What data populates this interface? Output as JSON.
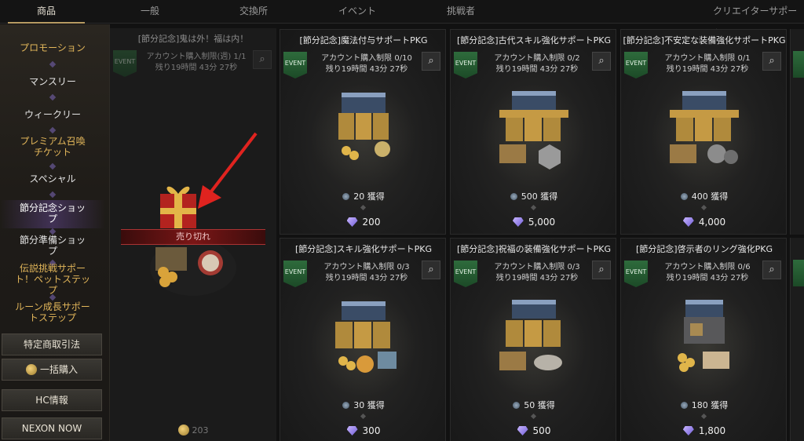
{
  "top_tabs": [
    {
      "label": "商品",
      "active": true
    },
    {
      "label": "一般",
      "active": false
    },
    {
      "label": "交換所",
      "active": false
    },
    {
      "label": "イベント",
      "active": false
    },
    {
      "label": "挑戦者",
      "active": false
    },
    {
      "label": "クリエイターサポート",
      "active": false
    }
  ],
  "sidebar": {
    "items": [
      {
        "label": "プロモーション"
      },
      {
        "label": "マンスリー"
      },
      {
        "label": "ウィークリー"
      },
      {
        "label": "プレミアム召喚チケット"
      },
      {
        "label": "スペシャル"
      },
      {
        "label": "節分記念ショップ"
      },
      {
        "label": "節分準備ショップ"
      },
      {
        "label": "伝説挑戦サポート！ペットステップ"
      },
      {
        "label": "ルーン成長サポートステップ"
      }
    ],
    "buttons": {
      "legal": "特定商取引法",
      "bulk": "一括購入",
      "hc": "HC情報",
      "nexon": "NEXON NOW"
    }
  },
  "promo_card": {
    "title": "[節分記念]鬼は外！福は内！",
    "limit": "アカウント購入制限(週) 1/1",
    "remaining": "残り19時間 43分 27秒",
    "badge": "EVENT",
    "soldout": "売り切れ",
    "price": "203"
  },
  "cards": [
    {
      "title": "[節分記念]魔法付与サポートPKG",
      "limit": "アカウント購入制限 0/10",
      "remaining": "残り19時間 43分 27秒",
      "badge": "EVENT",
      "obtain": "20 獲得",
      "price": "200"
    },
    {
      "title": "[節分記念]古代スキル強化サポートPKG",
      "limit": "アカウント購入制限 0/2",
      "remaining": "残り19時間 43分 27秒",
      "badge": "EVENT",
      "obtain": "500 獲得",
      "price": "5,000"
    },
    {
      "title": "[節分記念]不安定な装備強化サポートPKG",
      "limit": "アカウント購入制限 0/1",
      "remaining": "残り19時間 43分 27秒",
      "badge": "EVENT",
      "obtain": "400 獲得",
      "price": "4,000"
    },
    {
      "title": "[節分記念]スキル強化サポートPKG",
      "limit": "アカウント購入制限 0/3",
      "remaining": "残り19時間 43分 27秒",
      "badge": "EVENT",
      "obtain": "30 獲得",
      "price": "300"
    },
    {
      "title": "[節分記念]祝福の装備強化サポートPKG",
      "limit": "アカウント購入制限 0/3",
      "remaining": "残り19時間 43分 27秒",
      "badge": "EVENT",
      "obtain": "50 獲得",
      "price": "500"
    },
    {
      "title": "[節分記念]啓示者のリング強化PKG",
      "limit": "アカウント購入制限 0/6",
      "remaining": "残り19時間 43分 27秒",
      "badge": "EVENT",
      "obtain": "180 獲得",
      "price": "1,800"
    }
  ],
  "colors": {
    "accent_gold": "#e2b65a",
    "event_green": "#2e6b3c",
    "soldout_red": "#7a1616",
    "arrow_red": "#e0231f"
  }
}
